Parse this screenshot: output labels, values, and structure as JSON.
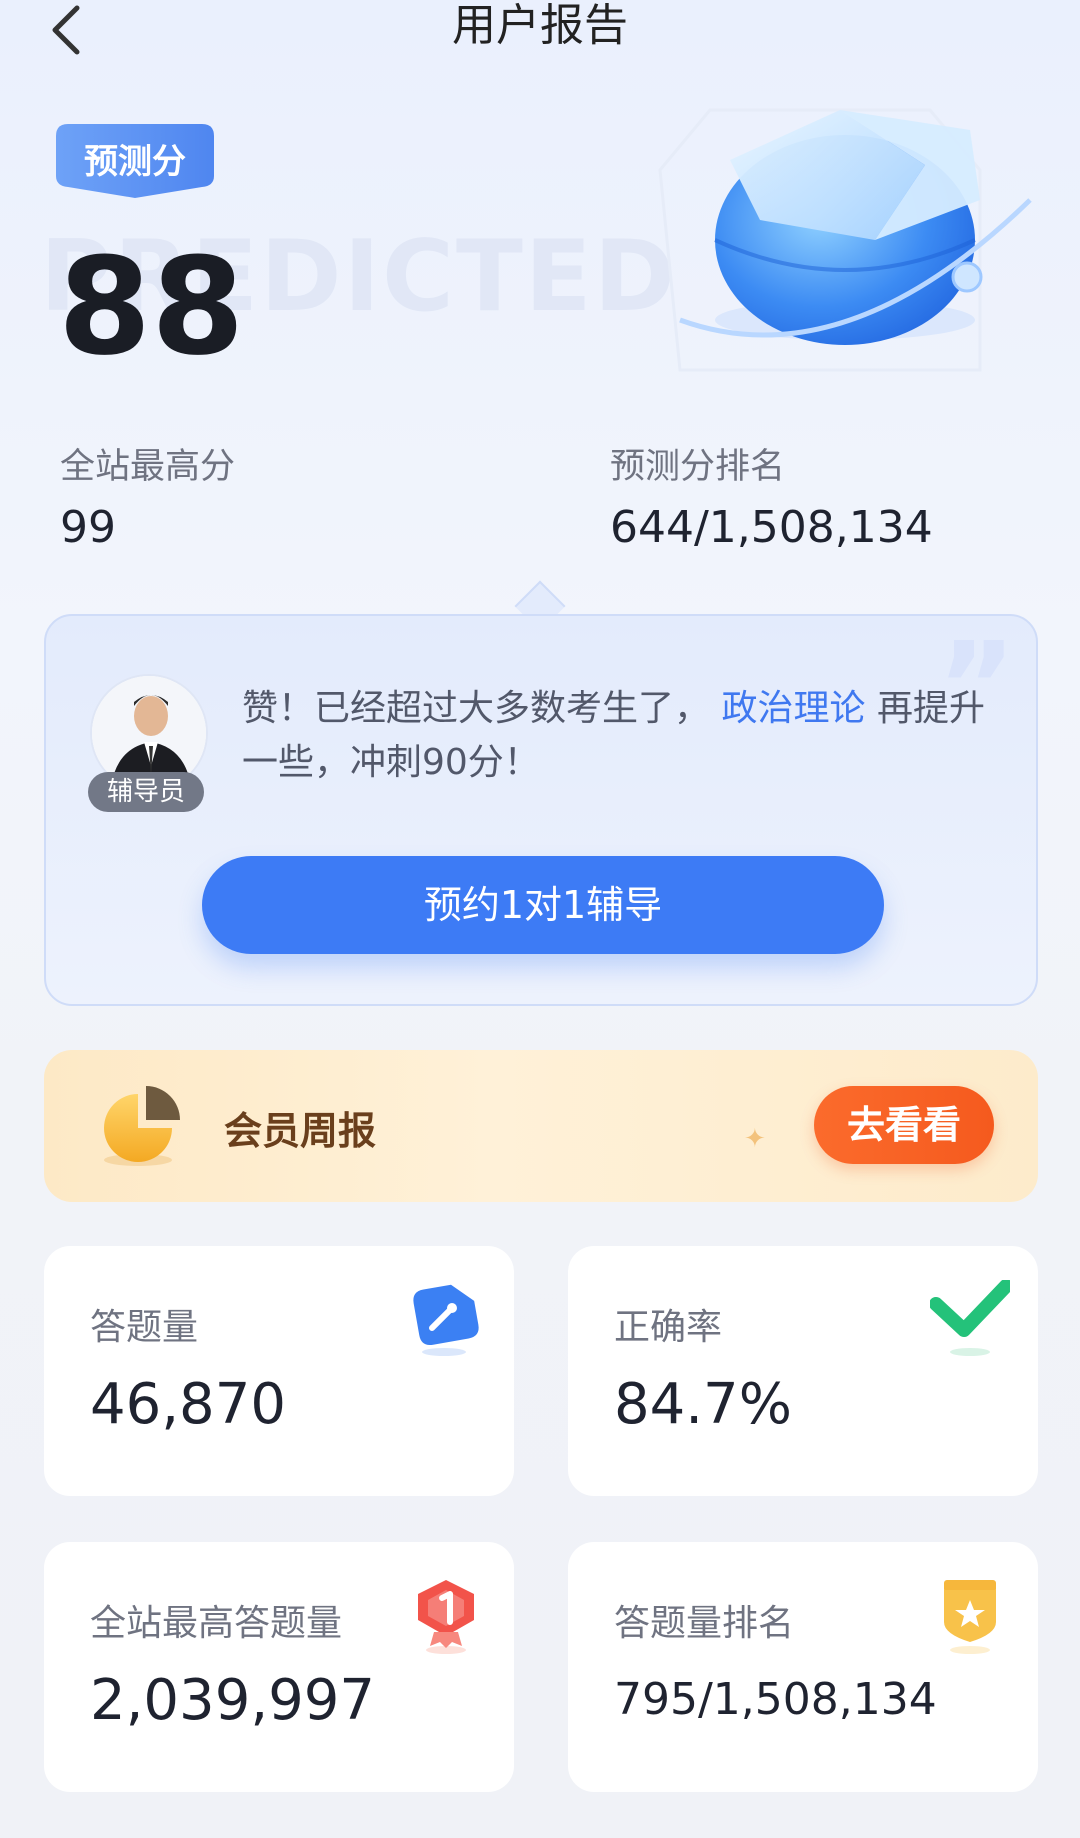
{
  "header": {
    "title": "用户报告",
    "back_icon": "chevron-left-icon"
  },
  "score": {
    "tag": "预测分",
    "value": "88",
    "watermark": "PREDICTED",
    "max_label": "全站最高分",
    "max_value": "99",
    "rank_label": "预测分排名",
    "rank_value": "644/1,508,134"
  },
  "tutor": {
    "badge": "辅导员",
    "message_before": "赞！已经超过大多数考生了，",
    "highlight": "政治理论",
    "message_after": " 再提升一些，冲刺90分！",
    "button": "预约1对1辅导"
  },
  "member": {
    "title": "会员周报",
    "button": "去看看"
  },
  "stats": [
    {
      "label": "答题量",
      "value": "46,870",
      "icon": "pencil-icon"
    },
    {
      "label": "正确率",
      "value": "84.7%",
      "icon": "check-icon"
    },
    {
      "label": "全站最高答题量",
      "value": "2,039,997",
      "icon": "rank-one-badge-icon"
    },
    {
      "label": "答题量排名",
      "value": "795/1,508,134",
      "icon": "star-shield-icon"
    }
  ],
  "colors": {
    "accent": "#3d7bf5",
    "orange": "#f55a1e",
    "highlight": "#3f78f0"
  }
}
